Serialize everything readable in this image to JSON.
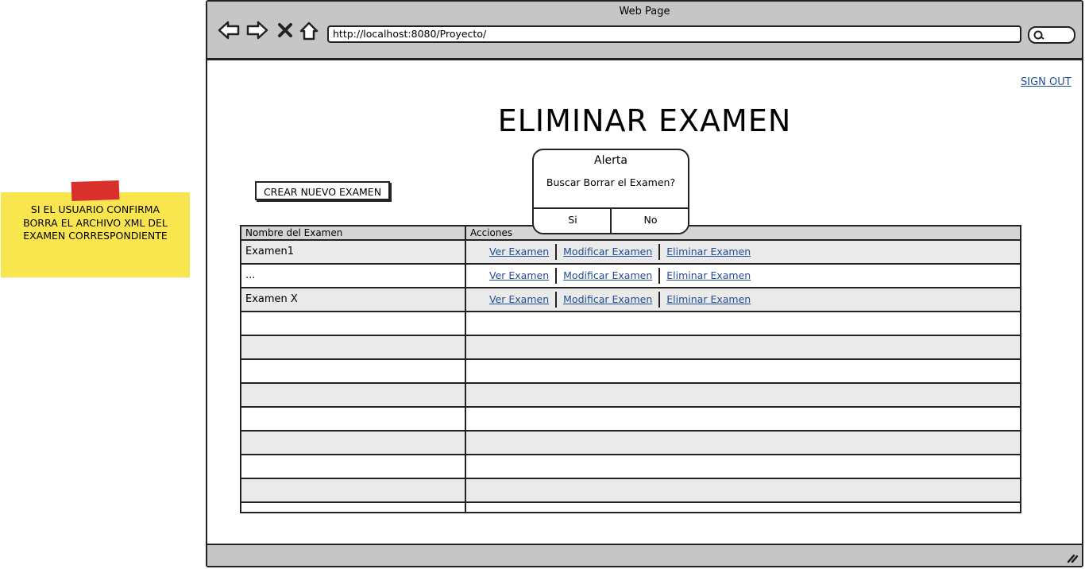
{
  "note": {
    "lines": [
      "SI EL USUARIO CONFIRMA",
      "BORRA EL ARCHIVO XML DEL",
      "EXAMEN  CORRESPONDIENTE"
    ],
    "color": "#f9e64f",
    "tape_color": "#d9302c"
  },
  "window": {
    "title": "Web Page",
    "url": "http://localhost:8080/Proyecto/"
  },
  "page": {
    "signout_label": "SIGN OUT",
    "title": "ELIMINAR EXAMEN",
    "create_button": "CREAR NUEVO EXAMEN"
  },
  "table": {
    "headers": [
      "Nombre del Examen",
      "Acciones"
    ],
    "rows": [
      {
        "name": "Examen1",
        "actions": [
          "Ver Examen",
          "Modificar Examen",
          "Eliminar Examen"
        ]
      },
      {
        "name": "...",
        "actions": [
          "Ver Examen",
          "Modificar Examen",
          "Eliminar Examen"
        ]
      },
      {
        "name": "Examen X",
        "actions": [
          "Ver Examen",
          "Modificar Examen",
          "Eliminar Examen"
        ]
      },
      {
        "name": "",
        "actions": []
      },
      {
        "name": "",
        "actions": []
      },
      {
        "name": "",
        "actions": []
      },
      {
        "name": "",
        "actions": []
      },
      {
        "name": "",
        "actions": []
      },
      {
        "name": "",
        "actions": []
      },
      {
        "name": "",
        "actions": []
      },
      {
        "name": "",
        "actions": []
      }
    ]
  },
  "dialog": {
    "title": "Alerta",
    "message": "Buscar Borrar el Examen?",
    "yes_label": "Si",
    "no_label": "No"
  },
  "colors": {
    "link": "#1f4e96",
    "chrome": "#c6c6c6"
  }
}
